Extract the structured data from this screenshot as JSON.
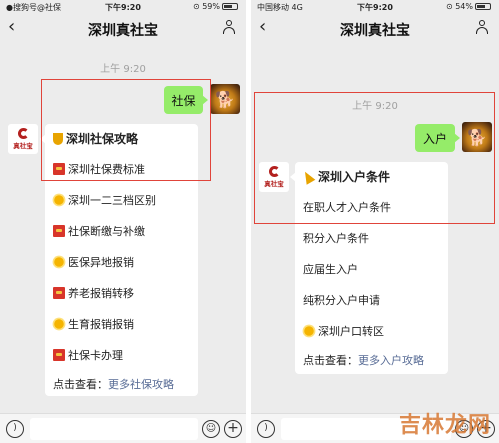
{
  "left": {
    "status": {
      "carrier": "●搜狗号@社保",
      "time": "下午9:20",
      "battery": "⊙ 59%"
    },
    "nav": {
      "title": "深圳真社宝"
    },
    "timestamp": "上午 9:20",
    "user_message": "社保",
    "brand_avatar": "真社宝",
    "reply": {
      "items": [
        {
          "icon": "trophy-icon",
          "text": "深圳社保攻略"
        },
        {
          "icon": "red-envelope-icon",
          "text": "深圳社保费标准"
        },
        {
          "icon": "sun-icon",
          "text": "深圳一二三档区别"
        },
        {
          "icon": "red-envelope-icon",
          "text": "社保断缴与补缴"
        },
        {
          "icon": "sun-icon",
          "text": "医保异地报销"
        },
        {
          "icon": "red-envelope-icon",
          "text": "养老报销转移"
        },
        {
          "icon": "sun-icon",
          "text": "生育报销报销"
        },
        {
          "icon": "red-envelope-icon",
          "text": "社保卡办理"
        }
      ],
      "footer_prefix": "点击查看：",
      "footer_link": "更多社保攻略"
    }
  },
  "right": {
    "status": {
      "carrier": "中国移动 4G",
      "time": "下午9:20",
      "battery": "⊙ 54%"
    },
    "nav": {
      "title": "深圳真社宝"
    },
    "timestamp": "上午 9:20",
    "user_message": "入户",
    "brand_avatar": "真社宝",
    "reply": {
      "items": [
        {
          "icon": "party-popper-icon",
          "text": "深圳入户条件"
        },
        {
          "icon": "",
          "text": "在职人才入户条件"
        },
        {
          "icon": "",
          "text": "积分入户条件"
        },
        {
          "icon": "",
          "text": "应届生入户"
        },
        {
          "icon": "",
          "text": "纯积分入户申请"
        },
        {
          "icon": "sun-icon",
          "text": "深圳户口转区"
        }
      ],
      "footer_prefix": "点击查看：",
      "footer_link": "更多入户攻略"
    }
  },
  "watermark": "吉林龙网",
  "colors": {
    "chat_background": "#ececec",
    "sent_bubble": "#95ec69",
    "received_bubble": "#ffffff",
    "highlight_border": "#e0443a",
    "link": "#576b95"
  }
}
